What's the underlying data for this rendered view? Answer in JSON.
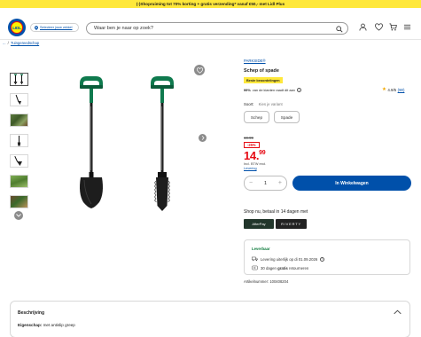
{
  "promo": {
    "text": "(-)Shopruiming tot 70% korting + gratis verzending* vanaf €50,- met Lidl Plus"
  },
  "header": {
    "logo_text": "LIDL",
    "store_label": "Selecteer jouw winkel",
    "search_placeholder": "Waar ben je naar op zoek?"
  },
  "breadcrumb": {
    "sep": "/",
    "item": "Tuingereedschap"
  },
  "product": {
    "brand": "PARKSIDE®",
    "title": "Schep of spade",
    "badge": "Beste beoordelingen",
    "reco_pct": "99%",
    "reco_text": "van de klanten raadt dit aan",
    "rating": "4.9/5",
    "rating_count": "(90)",
    "variant_label": "Soort:",
    "variant_hint": "Kies je variant",
    "variants": [
      "Schep",
      "Spade"
    ],
    "old_price": "19.99",
    "discount": "-25%",
    "price_int": "14.",
    "price_dec": "99",
    "vat_note": "Incl. BTW excl.",
    "vat_link": "Levering",
    "qty": "1",
    "cart_label": "In Winkelwagen",
    "shop_now": "Shop nu, betaal in 14 dagen met",
    "pay_options": [
      "AfterPay",
      "RIVERTY"
    ],
    "availability": "Leverbaar",
    "delivery_text": "Levering uiterlijk op di 01.09.2026",
    "return_pre": "30 dagen ",
    "return_bold": "gratis",
    "return_post": " retourneren",
    "article_nr": "Artikelnummer: 100408204"
  },
  "description": {
    "heading": "Beschrijving",
    "feature_label": "Eigenschap:",
    "feature_value": " met antislip greep"
  },
  "colors": {
    "brand_blue": "#0050aa",
    "promo_yellow": "#ffe83b",
    "price_red": "#e60a14",
    "grip_green": "#0f7a4e"
  }
}
